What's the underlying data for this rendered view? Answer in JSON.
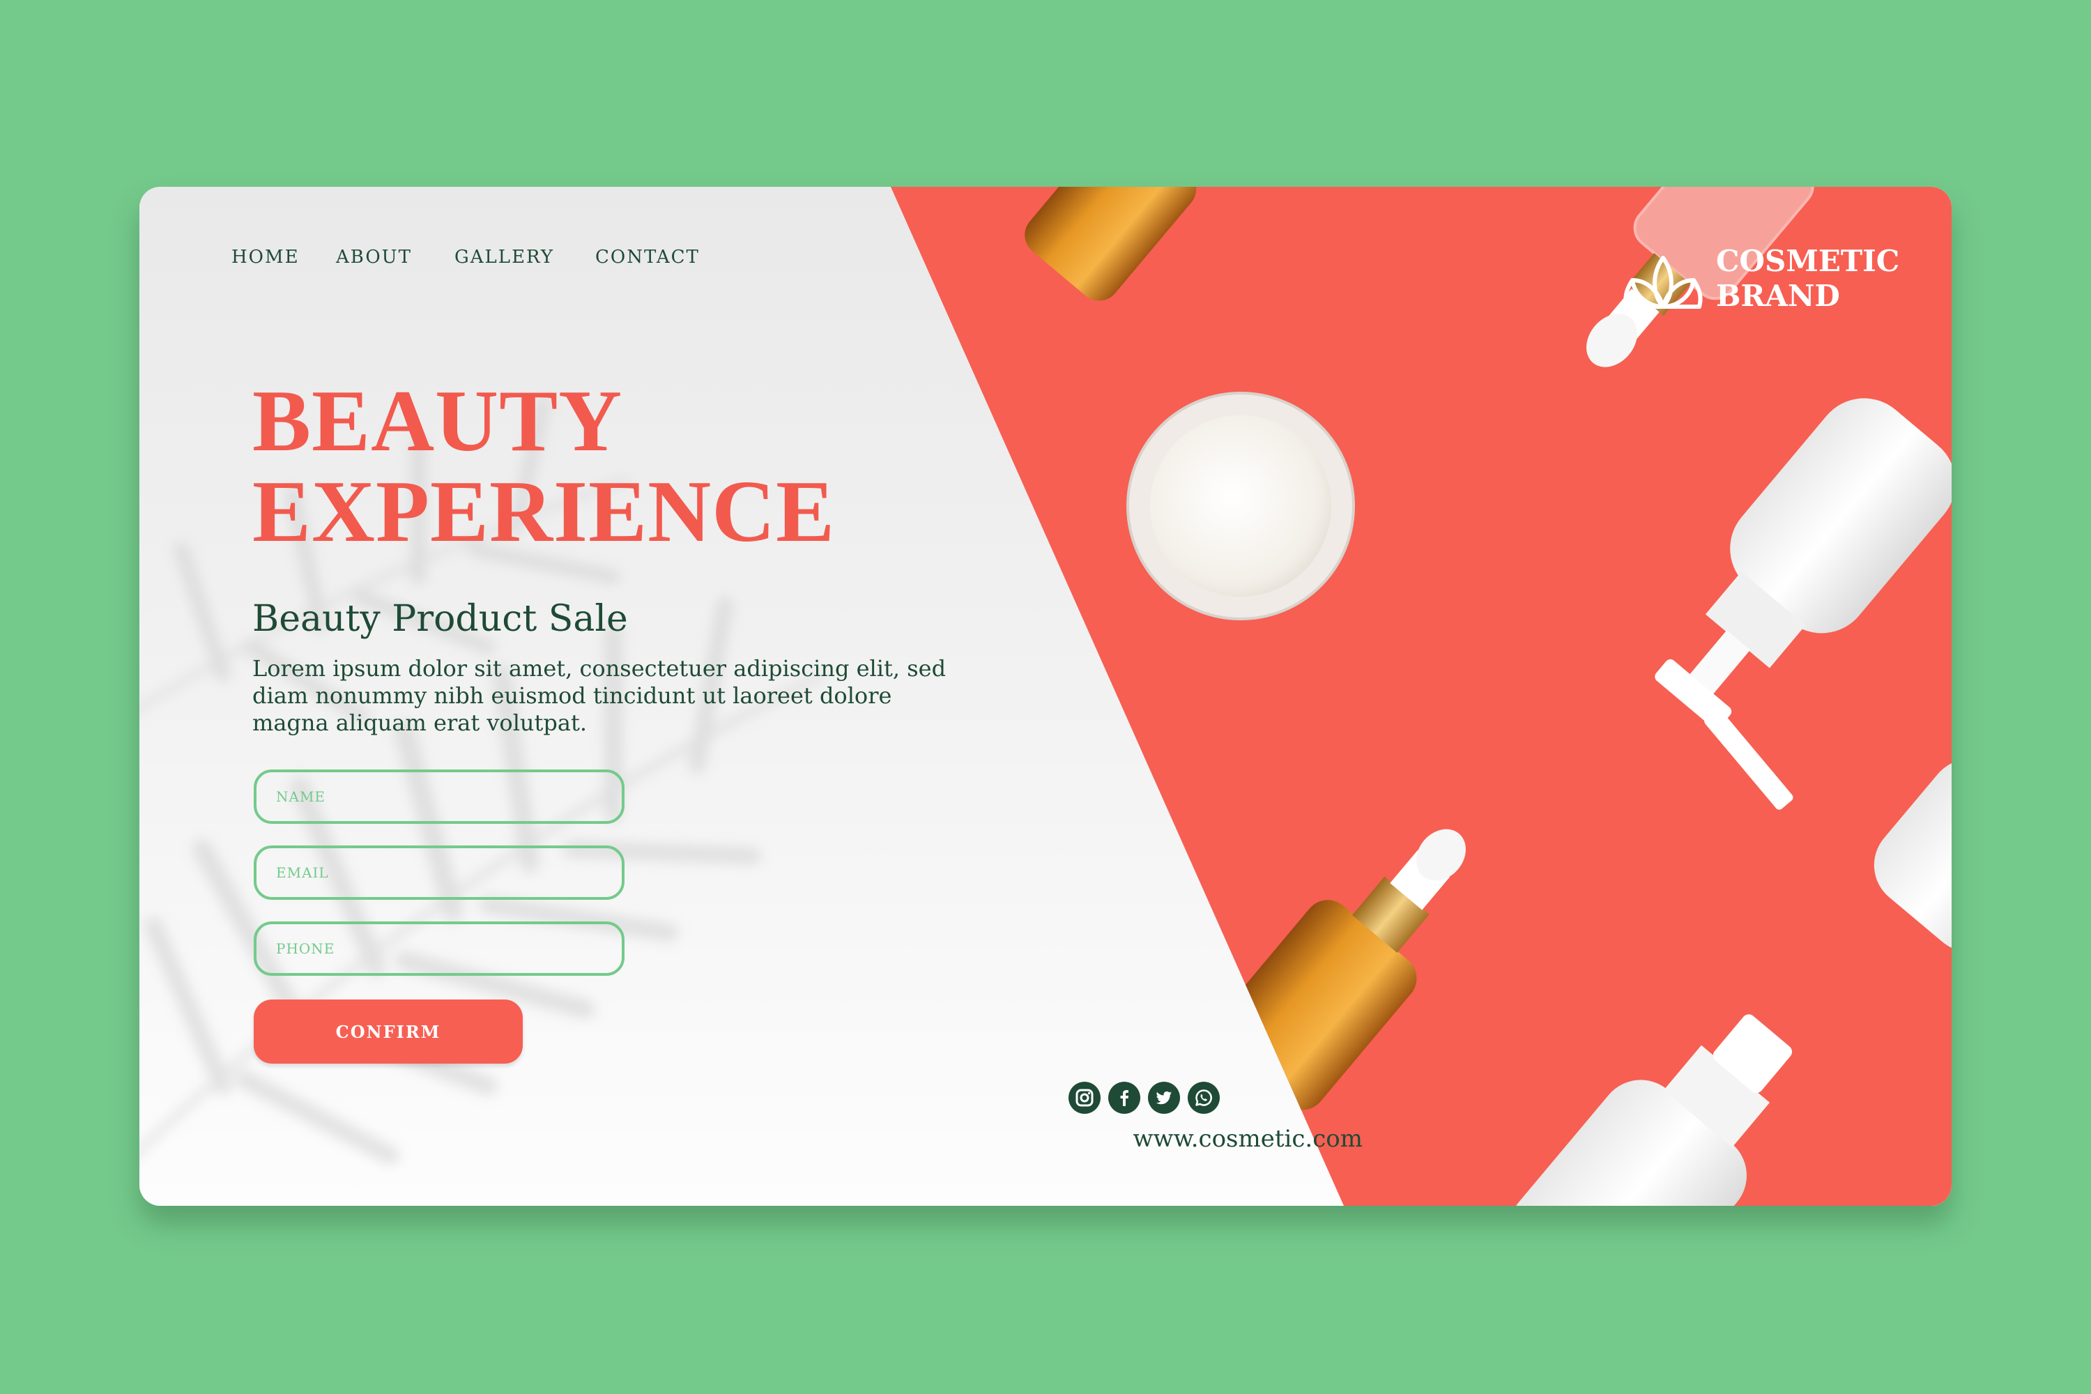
{
  "nav": {
    "items": [
      {
        "label": "HOME"
      },
      {
        "label": "ABOUT"
      },
      {
        "label": "GALLERY"
      },
      {
        "label": "CONTACT"
      }
    ]
  },
  "hero": {
    "title_line1": "BEAUTY",
    "title_line2": "EXPERIENCE",
    "subtitle": "Beauty Product Sale",
    "body": "Lorem ipsum dolor sit amet, consectetuer adipiscing elit, sed diam nonummy nibh euismod tincidunt ut laoreet dolore magna aliquam erat volutpat."
  },
  "form": {
    "name_placeholder": "NAME",
    "email_placeholder": "EMAIL",
    "phone_placeholder": "PHONE",
    "confirm_label": "CONFIRM"
  },
  "footer": {
    "socials": [
      {
        "icon": "instagram-icon"
      },
      {
        "icon": "facebook-icon"
      },
      {
        "icon": "twitter-icon"
      },
      {
        "icon": "whatsapp-icon"
      }
    ],
    "url": "www.cosmetic.com"
  },
  "brand": {
    "line1": "COSMETIC",
    "line2": "BRAND",
    "logo_icon": "lotus-icon"
  },
  "colors": {
    "background": "#74ca8b",
    "coral": "#f75f52",
    "title": "#f25a4e",
    "dark_green": "#1e4a36",
    "panel": "#ececec"
  }
}
